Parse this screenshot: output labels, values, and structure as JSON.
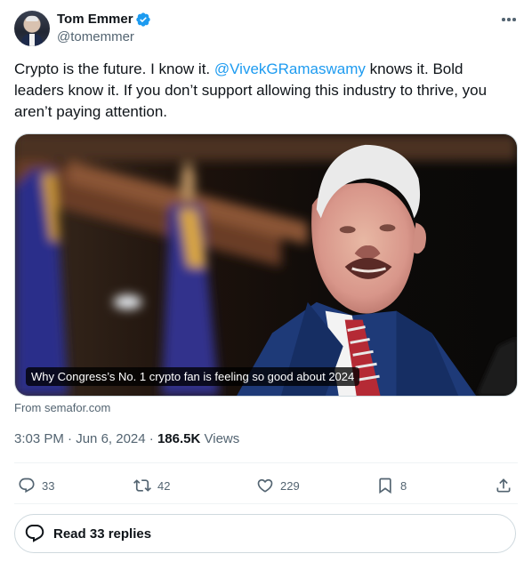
{
  "author": {
    "name": "Tom Emmer",
    "handle": "@tomemmer",
    "verified": true
  },
  "tweet": {
    "text_before": "Crypto is the future. I know it. ",
    "mention": "@VivekGRamaswamy",
    "text_after": " knows it. Bold leaders know it. If you don’t support allowing this industry to thrive, you aren’t paying attention."
  },
  "card": {
    "caption": "Why Congress’s No. 1 crypto fan is feeling so good about 2024",
    "source": "From semafor.com"
  },
  "meta": {
    "time": "3:03 PM",
    "separator": " · ",
    "date": "Jun 6, 2024",
    "separator2": " · ",
    "views_count": "186.5K",
    "views_label": " Views"
  },
  "actions": {
    "replies": "33",
    "reposts": "42",
    "likes": "229",
    "bookmarks": "8"
  },
  "read_replies": "Read 33 replies",
  "colors": {
    "accent": "#1d9bf0",
    "text": "#0f1419",
    "muted": "#536471",
    "border": "#cfd9de"
  }
}
